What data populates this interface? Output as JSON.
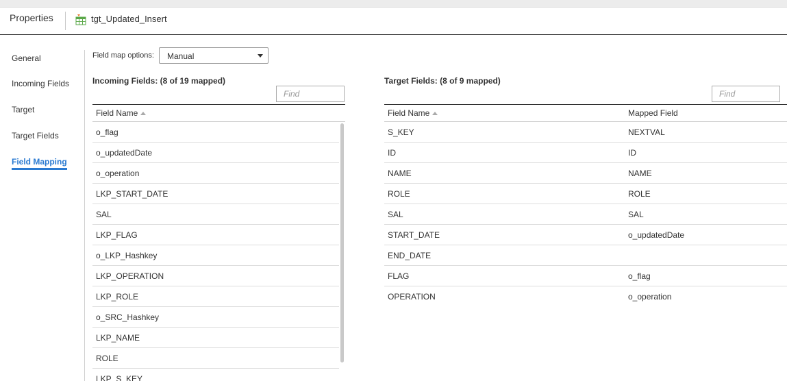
{
  "header": {
    "properties_label": "Properties",
    "target_name": "tgt_Updated_Insert",
    "target_icon": "target-table-icon"
  },
  "sidenav": {
    "items": [
      {
        "label": "General",
        "active": false
      },
      {
        "label": "Incoming Fields",
        "active": false
      },
      {
        "label": "Target",
        "active": false
      },
      {
        "label": "Target Fields",
        "active": false
      },
      {
        "label": "Field Mapping",
        "active": true
      }
    ]
  },
  "field_map_options": {
    "label": "Field map options:",
    "selected": "Manual"
  },
  "incoming": {
    "title": "Incoming Fields: (8 of 19 mapped)",
    "find_placeholder": "Find",
    "column_header": "Field Name",
    "rows": [
      "o_flag",
      "o_updatedDate",
      "o_operation",
      "LKP_START_DATE",
      "SAL",
      "LKP_FLAG",
      "o_LKP_Hashkey",
      "LKP_OPERATION",
      "LKP_ROLE",
      "o_SRC_Hashkey",
      "LKP_NAME",
      "ROLE",
      "LKP_S_KEY"
    ]
  },
  "target": {
    "title": "Target Fields: (8 of 9 mapped)",
    "find_placeholder": "Find",
    "column_header_name": "Field Name",
    "column_header_mapped": "Mapped Field",
    "rows": [
      {
        "name": "S_KEY",
        "mapped": "NEXTVAL"
      },
      {
        "name": "ID",
        "mapped": "ID"
      },
      {
        "name": "NAME",
        "mapped": "NAME"
      },
      {
        "name": "ROLE",
        "mapped": "ROLE"
      },
      {
        "name": "SAL",
        "mapped": "SAL"
      },
      {
        "name": "START_DATE",
        "mapped": "o_updatedDate"
      },
      {
        "name": "END_DATE",
        "mapped": ""
      },
      {
        "name": "FLAG",
        "mapped": "o_flag"
      },
      {
        "name": "OPERATION",
        "mapped": "o_operation"
      }
    ]
  },
  "colors": {
    "accent": "#2a7ad1",
    "icon_green": "#5aa848",
    "icon_orange": "#e8732a"
  }
}
